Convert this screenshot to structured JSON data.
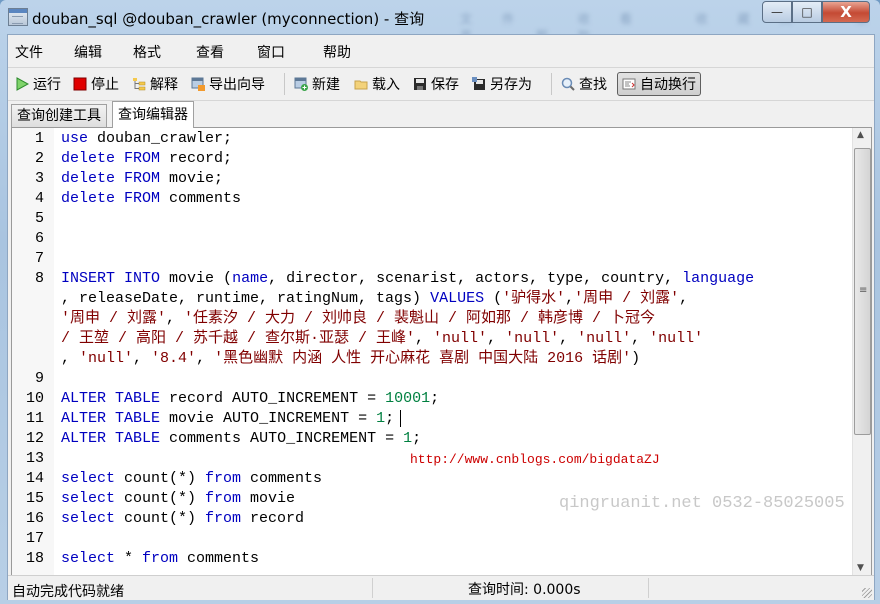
{
  "window": {
    "title": "douban_sql @douban_crawler (myconnection) - 查询",
    "blurred_title_text": "文件 收看 收藏夹 工具 帮助",
    "minimize_label": "—",
    "maximize_label": "□",
    "close_label": "X"
  },
  "menubar": {
    "items": [
      {
        "label": "文件"
      },
      {
        "label": "编辑"
      },
      {
        "label": "格式"
      },
      {
        "label": "查看"
      },
      {
        "label": "窗口"
      },
      {
        "label": "帮助"
      }
    ]
  },
  "toolbar": {
    "run": "运行",
    "stop": "停止",
    "explain": "解释",
    "export_wizard": "导出向导",
    "new": "新建",
    "load": "载入",
    "save": "保存",
    "save_as": "另存为",
    "find": "查找",
    "word_wrap": "自动换行"
  },
  "tabs": [
    {
      "label": "查询创建工具",
      "active": false
    },
    {
      "label": "查询编辑器",
      "active": true
    }
  ],
  "editor": {
    "lines": [
      {
        "n": "1",
        "tokens": [
          {
            "t": "use",
            "c": "kw"
          },
          {
            "t": " douban_crawler;"
          }
        ]
      },
      {
        "n": "2",
        "tokens": [
          {
            "t": "delete",
            "c": "kw"
          },
          {
            "t": " "
          },
          {
            "t": "FROM",
            "c": "kw"
          },
          {
            "t": " record;"
          }
        ]
      },
      {
        "n": "3",
        "tokens": [
          {
            "t": "delete",
            "c": "kw"
          },
          {
            "t": " "
          },
          {
            "t": "FROM",
            "c": "kw"
          },
          {
            "t": " movie;"
          }
        ]
      },
      {
        "n": "4",
        "tokens": [
          {
            "t": "delete",
            "c": "kw"
          },
          {
            "t": " "
          },
          {
            "t": "FROM",
            "c": "kw"
          },
          {
            "t": " comments"
          }
        ]
      },
      {
        "n": "5",
        "tokens": []
      },
      {
        "n": "6",
        "tokens": []
      },
      {
        "n": "7",
        "tokens": []
      },
      {
        "n": "8",
        "tokens": [
          {
            "t": "INSERT",
            "c": "kw"
          },
          {
            "t": " "
          },
          {
            "t": "INTO",
            "c": "kw"
          },
          {
            "t": " movie ("
          },
          {
            "t": "name",
            "c": "kw"
          },
          {
            "t": ", director, scenarist, actors, type, country, "
          },
          {
            "t": "language",
            "c": "kw"
          }
        ]
      },
      {
        "n": "",
        "tokens": [
          {
            "t": ", releaseDate, runtime, ratingNum, tags) "
          },
          {
            "t": "VALUES",
            "c": "kw"
          },
          {
            "t": " ("
          },
          {
            "t": "'驴得水'",
            "c": "str"
          },
          {
            "t": ","
          },
          {
            "t": "'周申 / 刘露'",
            "c": "str"
          },
          {
            "t": ","
          }
        ]
      },
      {
        "n": "",
        "tokens": [
          {
            "t": "'周申 / 刘露'",
            "c": "str"
          },
          {
            "t": ", "
          },
          {
            "t": "'任素汐 / 大力 / 刘帅良 / 裴魁山 / 阿如那 / 韩彦博 / 卜冠今",
            "c": "str"
          }
        ]
      },
      {
        "n": "",
        "tokens": [
          {
            "t": "/ 王堃 / 高阳 / 苏千越 / 查尔斯·亚瑟 / 王峰'",
            "c": "str"
          },
          {
            "t": ", "
          },
          {
            "t": "'null'",
            "c": "str"
          },
          {
            "t": ", "
          },
          {
            "t": "'null'",
            "c": "str"
          },
          {
            "t": ", "
          },
          {
            "t": "'null'",
            "c": "str"
          },
          {
            "t": ", "
          },
          {
            "t": "'null'",
            "c": "str"
          }
        ]
      },
      {
        "n": "",
        "tokens": [
          {
            "t": ", "
          },
          {
            "t": "'null'",
            "c": "str"
          },
          {
            "t": ", "
          },
          {
            "t": "'8.4'",
            "c": "str"
          },
          {
            "t": ", "
          },
          {
            "t": "'黑色幽默 内涵 人性 开心麻花 喜剧 中国大陆 2016 话剧'",
            "c": "str"
          },
          {
            "t": ")"
          }
        ]
      },
      {
        "n": "9",
        "tokens": []
      },
      {
        "n": "10",
        "tokens": [
          {
            "t": "ALTER",
            "c": "kw"
          },
          {
            "t": " "
          },
          {
            "t": "TABLE",
            "c": "kw"
          },
          {
            "t": " record AUTO_INCREMENT = "
          },
          {
            "t": "10001",
            "c": "num"
          },
          {
            "t": ";"
          }
        ]
      },
      {
        "n": "11",
        "tokens": [
          {
            "t": "ALTER",
            "c": "kw"
          },
          {
            "t": " "
          },
          {
            "t": "TABLE",
            "c": "kw"
          },
          {
            "t": " movie AUTO_INCREMENT = "
          },
          {
            "t": "1",
            "c": "num"
          },
          {
            "t": ";"
          }
        ],
        "cursor": true
      },
      {
        "n": "12",
        "tokens": [
          {
            "t": "ALTER",
            "c": "kw"
          },
          {
            "t": " "
          },
          {
            "t": "TABLE",
            "c": "kw"
          },
          {
            "t": " comments AUTO_INCREMENT = "
          },
          {
            "t": "1",
            "c": "num"
          },
          {
            "t": ";"
          }
        ]
      },
      {
        "n": "13",
        "tokens": []
      },
      {
        "n": "14",
        "tokens": [
          {
            "t": "select",
            "c": "kw"
          },
          {
            "t": " count(*) "
          },
          {
            "t": "from",
            "c": "kw"
          },
          {
            "t": " comments"
          }
        ]
      },
      {
        "n": "15",
        "tokens": [
          {
            "t": "select",
            "c": "kw"
          },
          {
            "t": " count(*) "
          },
          {
            "t": "from",
            "c": "kw"
          },
          {
            "t": " movie"
          }
        ]
      },
      {
        "n": "16",
        "tokens": [
          {
            "t": "select",
            "c": "kw"
          },
          {
            "t": " count(*) "
          },
          {
            "t": "from",
            "c": "kw"
          },
          {
            "t": " record"
          }
        ]
      },
      {
        "n": "17",
        "tokens": []
      },
      {
        "n": "18",
        "tokens": [
          {
            "t": "select",
            "c": "kw"
          },
          {
            "t": " * "
          },
          {
            "t": "from",
            "c": "kw"
          },
          {
            "t": " comments"
          }
        ]
      }
    ],
    "overlay_url": "http://www.cnblogs.com/bigdataZJ",
    "watermark": "qingruanit.net 0532-85025005",
    "scroll_up": "▲",
    "scroll_down": "▼",
    "scroll_grip": "≡"
  },
  "statusbar": {
    "left": "自动完成代码就绪",
    "query_time": "查询时间: 0.000s"
  },
  "colors": {
    "keyword": "#0000c0",
    "string": "#800000",
    "number": "#008040",
    "url": "#cc0000"
  }
}
